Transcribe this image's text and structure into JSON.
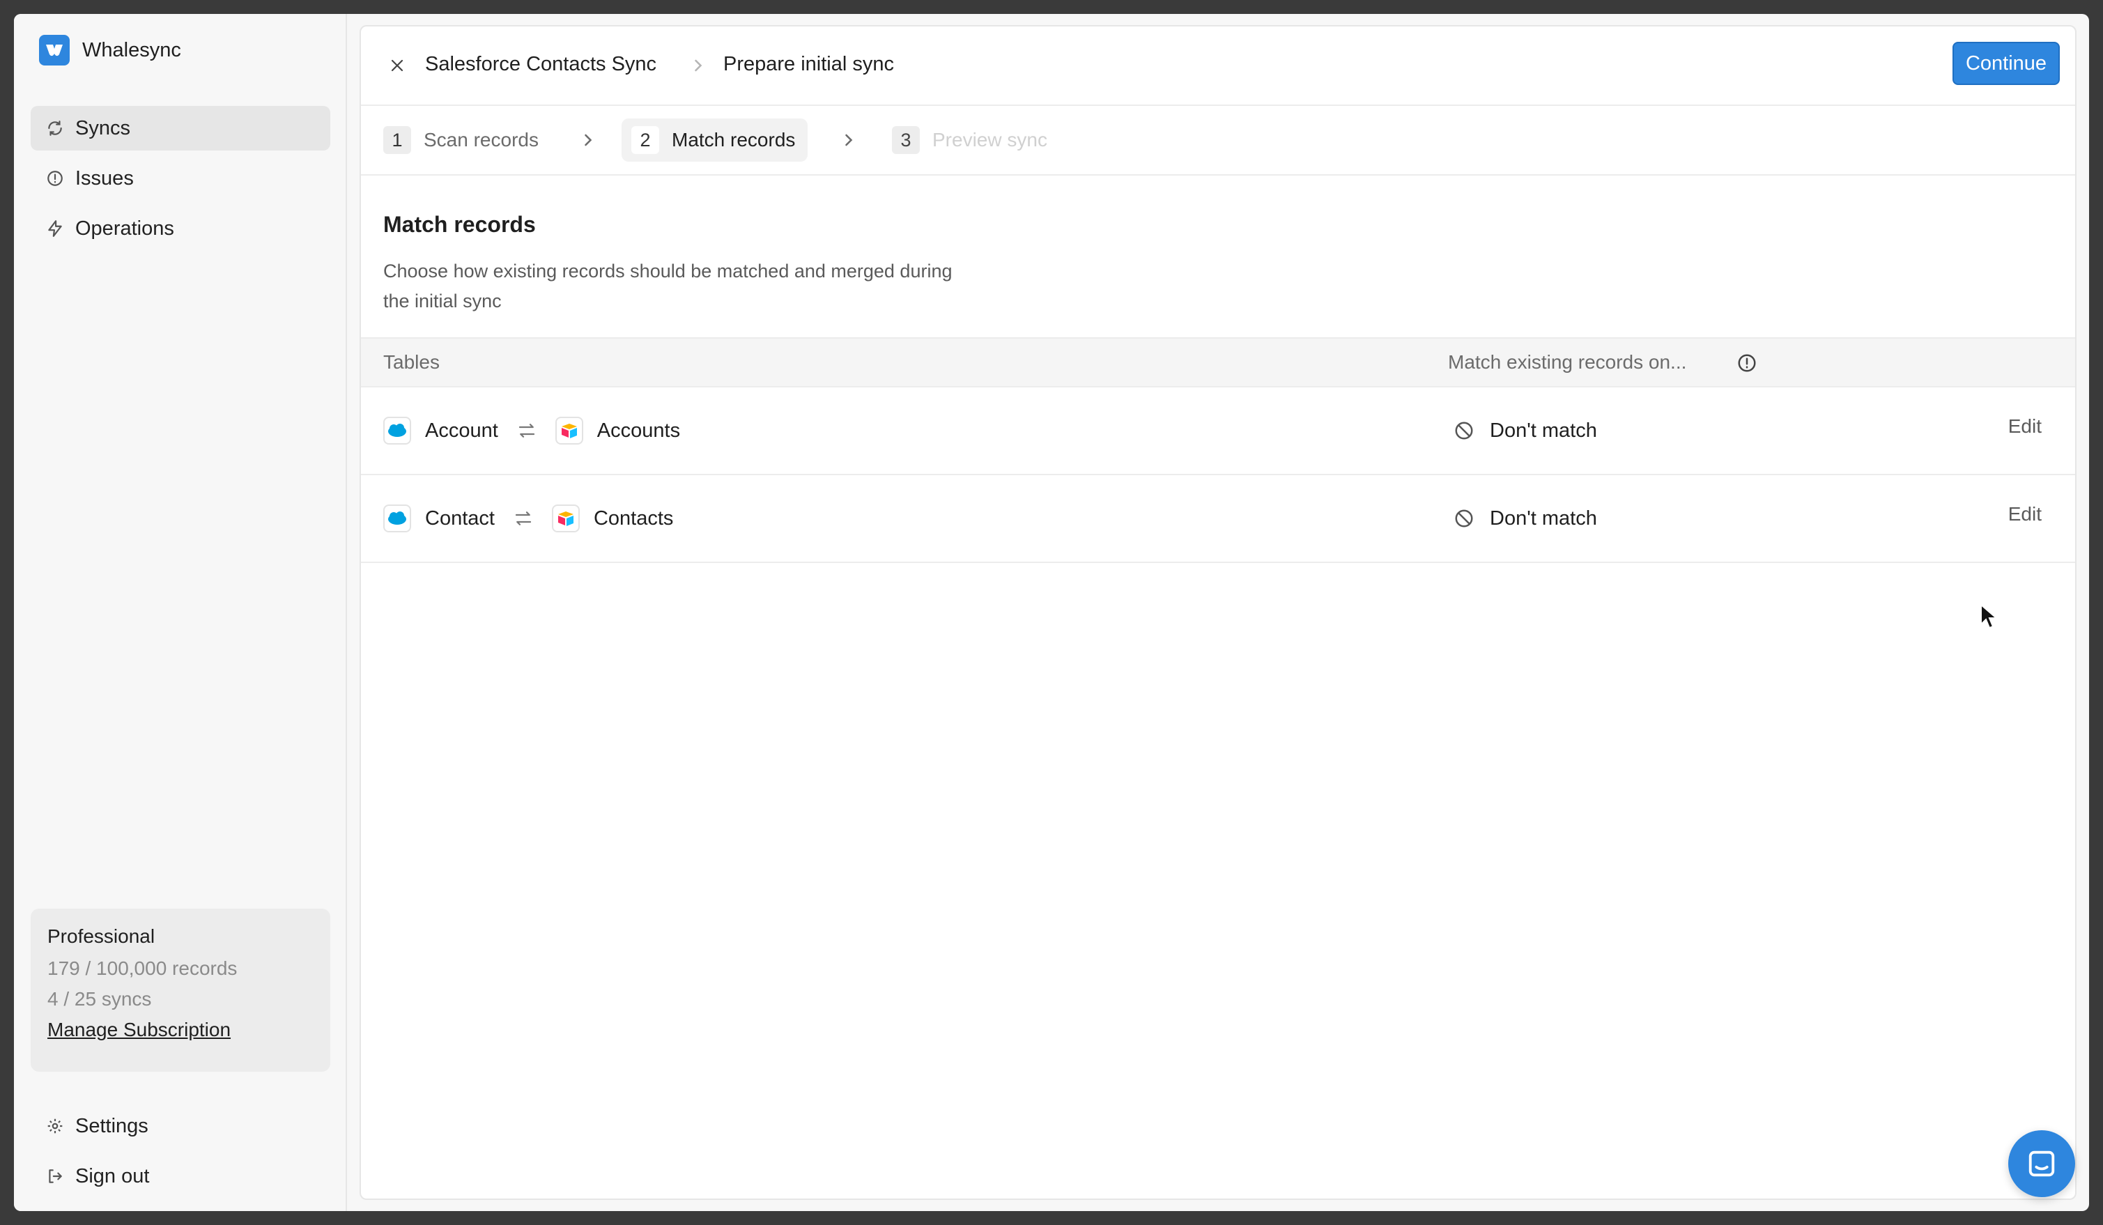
{
  "brand": {
    "name": "Whalesync",
    "logo_color": "#2e86de"
  },
  "nav": {
    "items": [
      {
        "label": "Syncs",
        "icon": "refresh-icon",
        "active": true
      },
      {
        "label": "Issues",
        "icon": "alert-circle-icon"
      },
      {
        "label": "Operations",
        "icon": "lightning-icon"
      }
    ],
    "bottom": [
      {
        "label": "Settings",
        "icon": "gear-icon"
      },
      {
        "label": "Sign out",
        "icon": "sign-out-icon"
      }
    ]
  },
  "plan": {
    "name": "Professional",
    "records": "179 / 100,000 records",
    "syncs": "4 / 25 syncs",
    "manage_link": "Manage Subscription"
  },
  "header": {
    "breadcrumb": [
      "Salesforce Contacts Sync",
      "Prepare initial sync"
    ],
    "continue_label": "Continue"
  },
  "steps": [
    {
      "num": "1",
      "label": "Scan records",
      "state": "done"
    },
    {
      "num": "2",
      "label": "Match records",
      "state": "active"
    },
    {
      "num": "3",
      "label": "Preview sync",
      "state": "disabled"
    }
  ],
  "section": {
    "title": "Match records",
    "description": "Choose how existing records should be matched and merged during the initial sync"
  },
  "table": {
    "headers": {
      "tables": "Tables",
      "match": "Match existing records on..."
    },
    "rows": [
      {
        "source": "Account",
        "target": "Accounts",
        "match": "Don't match",
        "action": "Edit"
      },
      {
        "source": "Contact",
        "target": "Contacts",
        "match": "Don't match",
        "action": "Edit"
      }
    ]
  },
  "colors": {
    "accent": "#2e86de",
    "salesforce": "#00a1e0"
  }
}
